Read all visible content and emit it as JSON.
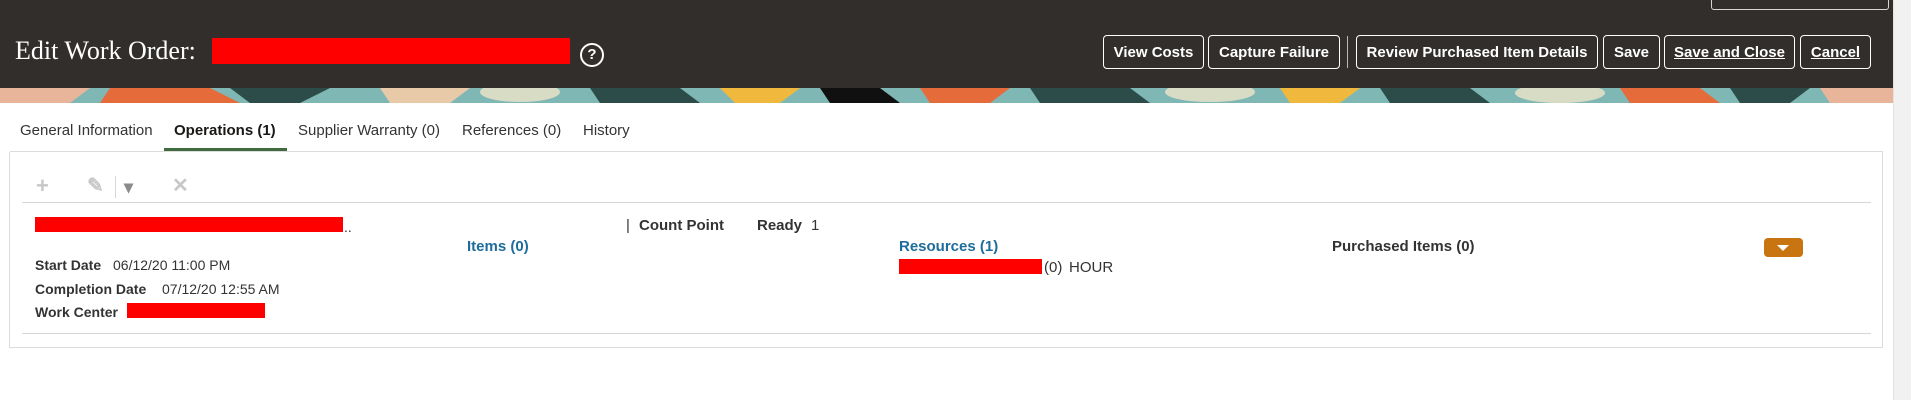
{
  "header": {
    "title": "Edit Work Order:",
    "help_icon": "?",
    "buttons": {
      "view_costs": "View Costs",
      "capture_failure": "Capture Failure",
      "review_purchased": "Review Purchased Item Details",
      "save": "Save",
      "save_and_close": "Save and Close",
      "cancel": "Cancel"
    }
  },
  "tabs": {
    "general": "General Information",
    "operations": "Operations (1)",
    "supplier_warranty": "Supplier Warranty (0)",
    "references": "References (0)",
    "history": "History"
  },
  "toolbar": {
    "add_icon": "+",
    "edit_icon": "✎",
    "dropdown_icon": "▾",
    "delete_icon": "✕"
  },
  "operation": {
    "name_suffix": "..",
    "start_date_label": "Start Date",
    "start_date": "06/12/20 11:00 PM",
    "completion_date_label": "Completion Date",
    "completion_date": "07/12/20 12:55 AM",
    "work_center_label": "Work Center",
    "items_link": "Items (0)",
    "separator": "|",
    "count_point": "Count Point",
    "ready_label": "Ready",
    "ready_value": "1",
    "resources_link": "Resources (1)",
    "resource_qty": "(0)",
    "resource_uom": "HOUR",
    "purchased_items": "Purchased Items (0)"
  },
  "colors": {
    "header_bg": "#322e2b",
    "active_tab_underline": "#3f6b3e",
    "link": "#1e6c9c",
    "actions_button": "#c77411",
    "redaction": "#ff0000"
  }
}
